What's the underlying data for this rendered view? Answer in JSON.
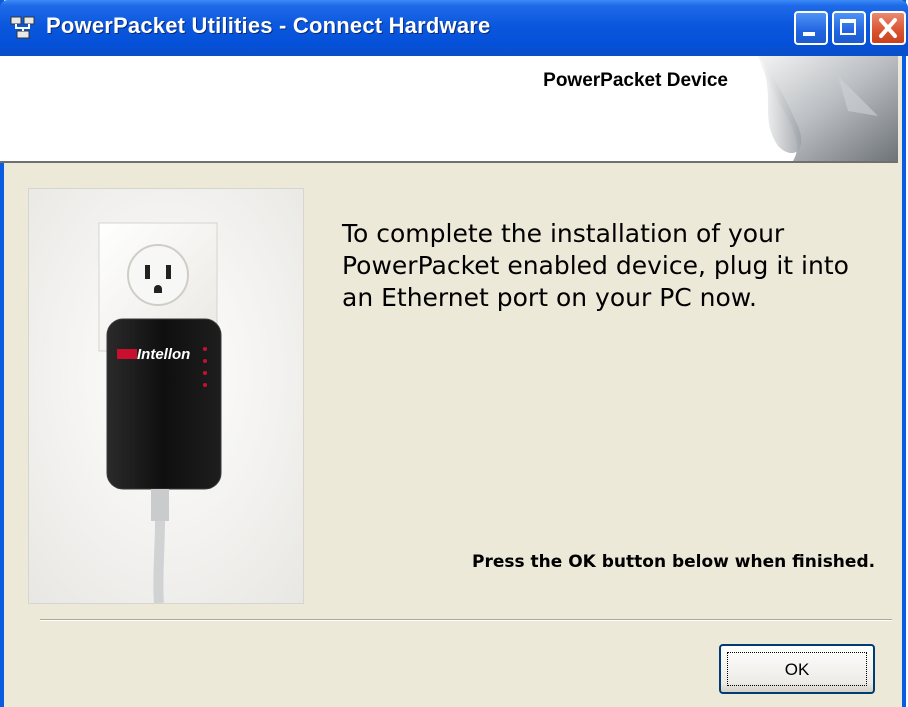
{
  "window": {
    "title": "PowerPacket Utilities - Connect Hardware",
    "controls": {
      "minimize": "minimize",
      "maximize": "maximize",
      "close": "close"
    }
  },
  "banner": {
    "title": "PowerPacket Device"
  },
  "content": {
    "instruction": "To complete the installation of your PowerPacket enabled device, plug it into an Ethernet port on your PC now.",
    "finish_note": "Press the OK button below when finished.",
    "device_brand": "Intellon"
  },
  "buttons": {
    "ok": "OK"
  },
  "colors": {
    "titlebar": "#0A58DE",
    "dialog_bg": "#ECE9D8",
    "close_button": "#D9532E"
  }
}
